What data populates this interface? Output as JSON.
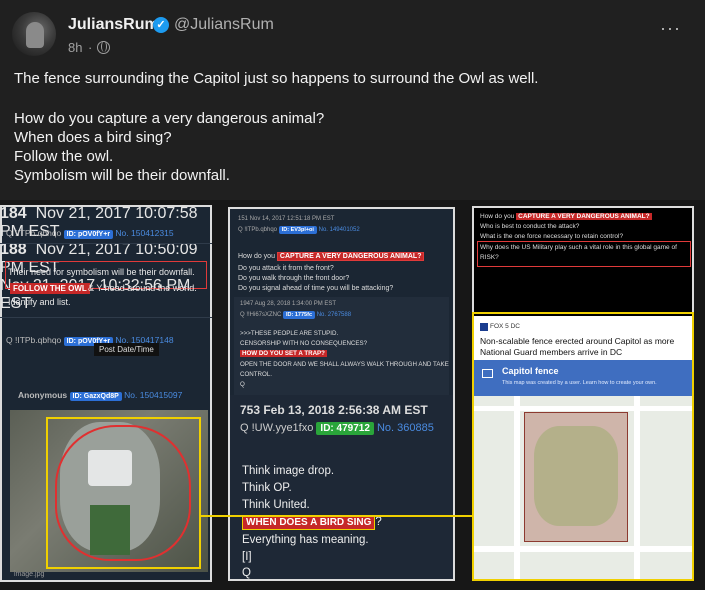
{
  "post": {
    "username": "JuliansRum",
    "handle": "@JuliansRum",
    "time": "8h",
    "lines": [
      "The fence surrounding the Capitol just so happens to surround the Owl as well.",
      "How do you capture a very dangerous animal?",
      "When does a bird sing?",
      "Follow the owl.",
      "Symbolism will be their downfall."
    ]
  },
  "panel1": {
    "post184_num": "184",
    "post184_date": "Nov 21, 2017 10:07:58 PM EST",
    "post184_trip": "Q !ITPb.qbhqo",
    "post184_id": "ID: pOV0fY+r",
    "post184_no": "No. 150412315",
    "post184_line1": "Their need for symbolism will be their downfall.",
    "post184_tag": "FOLLOW THE OWL",
    "post184_line2": "& Y head around the world.",
    "post184_line3": "Identify and list.",
    "post188_num": "188",
    "post188_date": "Nov 21, 2017 10:50:09 PM EST",
    "post188_trip": "Q !ITPb.qbhqo",
    "post188_id": "ID: pOV0fY+r",
    "post188_no": "No. 150417148",
    "tooltip": "Post Date/Time",
    "anon_date": "Nov 21, 2017 10:32:56 PM EST",
    "anon_name": "Anonymous",
    "anon_id": "ID: GazxQd8P",
    "anon_no": "No. 150415097",
    "image_label": "image.jpg"
  },
  "panel2": {
    "post151_head": "151  Nov 14, 2017 12:51:18 PM EST",
    "post151_trip": "Q !ITPb.qbhqo",
    "post151_id": "ID: EV3pl+oi",
    "post151_no": "No. 149401052",
    "tag1": "CAPTURE A VERY DANGEROUS ANIMAL?",
    "line1_pre": "How do you",
    "line2": "Do you attack it from the front?",
    "line3": "Do you walk through the front door?",
    "line4": "Do you signal ahead of time you will be attacking?",
    "post1947_head": "1947  Aug 28, 2018 1:34:00 PM EST",
    "post1947_trip": "Q !!Hi67sXZNC",
    "post1947_id": "ID: 1775fc",
    "post1947_no": "No. 2767588",
    "inner1": ">>>THESE PEOPLE ARE STUPID.",
    "inner2": "CENSORSHIP WITH NO CONSEQUENCES?",
    "tag2": "HOW DO YOU SET A TRAP?",
    "inner3": "OPEN THE DOOR AND WE SHALL ALWAYS WALK THROUGH AND TAKE",
    "inner4": "CONTROL.",
    "inner5": "Q",
    "big_head": "753  Feb 13, 2018 2:56:38 AM EST",
    "big_trip": "Q !UW.yye1fxo",
    "big_id": "ID: 479712",
    "big_no": "No. 360885",
    "big1": "Think image drop.",
    "big2": "Think OP.",
    "big3": "Think United.",
    "big_tag": "WHEN DOES A BIRD SING",
    "big_tag_suffix": "?",
    "big4": "Everything has meaning.",
    "big5": "[I]",
    "big6": "Q"
  },
  "panel3": {
    "l1_pre": "How do you",
    "l1_tag": "CAPTURE A VERY DANGEROUS ANIMAL?",
    "l2": "Who is best to conduct the attack?",
    "l3": "What is the one force necessary to retain control?",
    "l4": "Why does the US Military play such a vital role in this global game of",
    "l5": "RISK?",
    "news_src": "FOX 5 DC",
    "news_hl": "Non-scalable fence erected around Capitol as more National Guard members arrive in DC",
    "map_title": "Capitol fence",
    "map_sub": "This map was created by a user. Learn how to create your own."
  }
}
